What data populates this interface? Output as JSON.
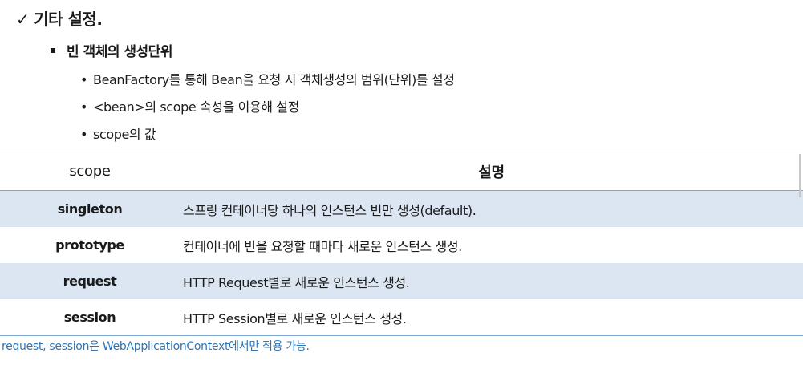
{
  "heading": {
    "check": "✓",
    "title": "기타 설정."
  },
  "sub_heading": "빈 객체의 생성단위",
  "points": [
    "BeanFactory를 통해 Bean을 요청 시 객체생성의 범위(단위)를 설정",
    "<bean>의 scope 속성을 이용해 설정",
    "scope의 값"
  ],
  "bullet_char": "•",
  "table": {
    "headers": [
      "scope",
      "설명"
    ],
    "rows": [
      {
        "scope": "singleton",
        "desc": "스프링 컨테이너당 하나의 인스턴스 빈만 생성(default)."
      },
      {
        "scope": "prototype",
        "desc": "컨테이너에 빈을 요청할 때마다 새로운 인스턴스 생성."
      },
      {
        "scope": "request",
        "desc": "HTTP Request별로 새로운 인스턴스 생성."
      },
      {
        "scope": "session",
        "desc": "HTTP Session별로 새로운 인스턴스 생성."
      }
    ]
  },
  "footnote": "request, session은 WebApplicationContext에서만 적용 가능.",
  "colors": {
    "row_shade": "#dce6f2",
    "table_border": "#7fa7cf",
    "footnote": "#2e74b5"
  }
}
